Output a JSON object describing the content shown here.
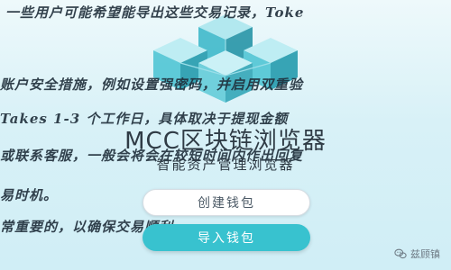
{
  "hero": {
    "title": "MCC区块链浏览器",
    "subtitle": "智能资产管理浏览器"
  },
  "background_text": [
    "一些用户可能希望能导出这些交易记录，Toke",
    "账户安全措施，例如设置强密码，并启用双重验",
    "Takes 1-3 个工作日，具体取决于提现金额",
    "或联系客服，一般会将会在较短时间内作出回复",
    "易时机。",
    "常重要的，以确保交易顺利"
  ],
  "buttons": {
    "create_wallet": "创建钱包",
    "import_wallet": "导入钱包"
  },
  "watermark": {
    "icon": "wechat-icon",
    "text": "兹顾镇"
  },
  "colors": {
    "accent": "#38c2cf",
    "cube_dark": "#0f8ea1",
    "cube_light": "#7dd8e4"
  }
}
